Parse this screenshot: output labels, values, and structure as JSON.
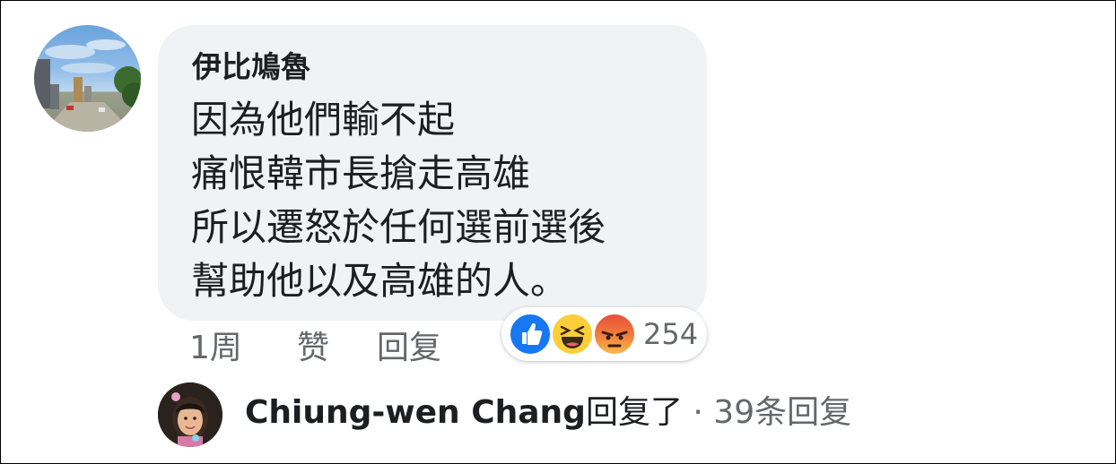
{
  "comment": {
    "author": "伊比鳩魯",
    "lines": [
      "因為他們輸不起",
      "痛恨韓市長搶走高雄",
      "所以遷怒於任何選前選後",
      "幫助他以及高雄的人。"
    ],
    "avatar_icon": "avatar-street-photo"
  },
  "actions": {
    "time": "1周",
    "like": "赞",
    "reply": "回复"
  },
  "reactions": {
    "icons": [
      "like-icon",
      "haha-icon",
      "angry-icon"
    ],
    "count": "254",
    "colors": {
      "like": "#1877f2",
      "haha": "#fbce3a",
      "angry": "#e8503a"
    }
  },
  "replies": {
    "name": "Chiung-wen Chang",
    "verb": "回复了",
    "count_text": " · 39条回复",
    "avatar_icon": "avatar-child-photo"
  }
}
